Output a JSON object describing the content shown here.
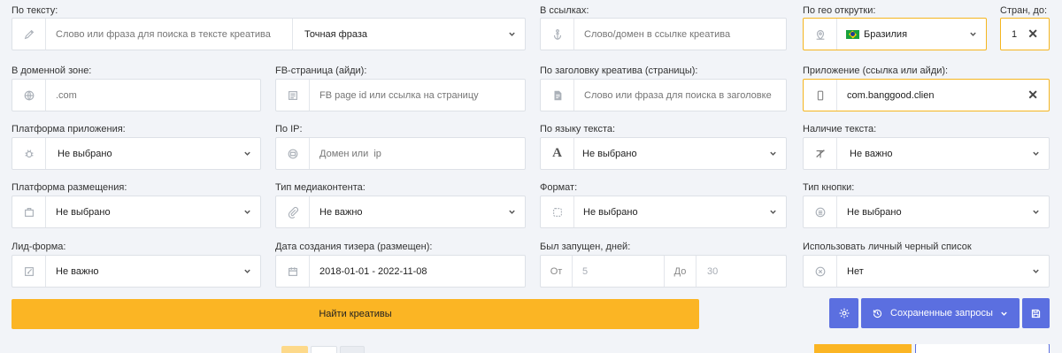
{
  "row1": {
    "text_label": "По тексту:",
    "text_placeholder": "Слово или фраза для поиска в тексте креатива",
    "text_mode": "Точная фраза",
    "links_label": "В ссылках:",
    "links_placeholder": "Слово/домен в ссылке креатива",
    "geo_label": "По гео открутки:",
    "geo_value": "Бразилия",
    "countries_label": "Стран, до:",
    "countries_value": "1"
  },
  "row2": {
    "domain_label": "В доменной зоне:",
    "domain_placeholder": ".com",
    "fb_label": "FB-страница (айди):",
    "fb_placeholder": "FB page id или ссылка на страницу",
    "title_label": "По заголовку креатива (страницы):",
    "title_placeholder": "Слово или фраза для поиска в заголовке",
    "app_label": "Приложение (ссылка или айди):",
    "app_value": "com.banggood.clien"
  },
  "row3": {
    "app_platform_label": "Платформа приложения:",
    "app_platform_value": "Не выбрано",
    "ip_label": "По IP:",
    "ip_placeholder": "Домен или  ip",
    "lang_label": "По языку текста:",
    "lang_value": "Не выбрано",
    "has_text_label": "Наличие текста:",
    "has_text_value": "Не важно"
  },
  "row4": {
    "placement_label": "Платформа размещения:",
    "placement_value": "Не выбрано",
    "media_label": "Тип медиаконтента:",
    "media_value": "Не важно",
    "format_label": "Формат:",
    "format_value": "Не выбрано",
    "button_type_label": "Тип кнопки:",
    "button_type_value": "Не выбрано"
  },
  "row5": {
    "lead_label": "Лид-форма:",
    "lead_value": "Не важно",
    "date_label": "Дата создания тизера (размещен):",
    "date_value": "2018-01-01 - 2022-11-08",
    "days_label": "Был запущен, дней:",
    "days_from_label": "От",
    "days_from_value": "5",
    "days_to_label": "До",
    "days_to_value": "30",
    "blacklist_label": "Использовать личный черный список",
    "blacklist_value": "Нет"
  },
  "actions": {
    "search_label": "Найти креативы",
    "saved_label": "Сохраненные запросы"
  },
  "colors": {
    "accent_yellow": "#fbb524",
    "accent_blue": "#5b6fe0",
    "highlight_border": "#f5b51f"
  }
}
